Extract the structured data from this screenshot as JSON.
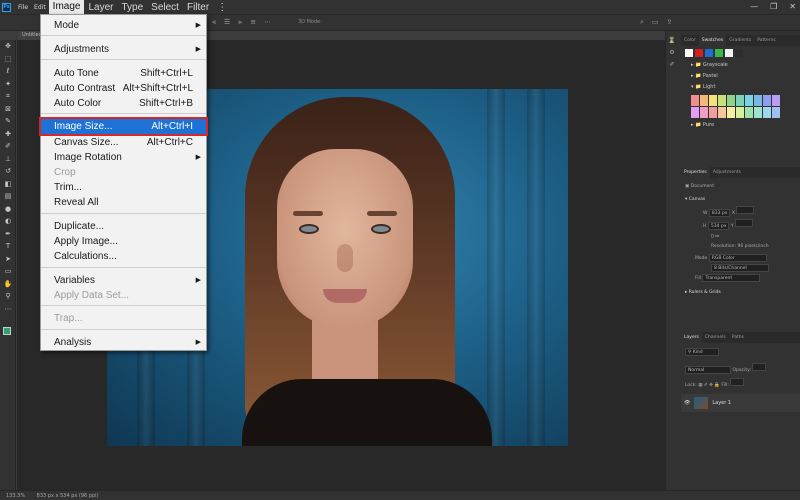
{
  "app": {
    "logo": "Ps",
    "menubar": [
      "File",
      "Edit",
      "Image",
      "Layer",
      "Type",
      "Select",
      "Filter"
    ],
    "more_menus": "⋮",
    "window_controls": [
      "—",
      "❐",
      "✕"
    ]
  },
  "options_bar": {
    "mode_3d": "3D Mode:"
  },
  "document_tab": "Untitled-1",
  "image_menu": {
    "items": [
      {
        "label": "Mode",
        "shortcut": "",
        "submenu": true,
        "disabled": false
      },
      {
        "label": "Adjustments",
        "shortcut": "",
        "submenu": true,
        "disabled": false
      },
      {
        "label": "Auto Tone",
        "shortcut": "Shift+Ctrl+L",
        "submenu": false,
        "disabled": false
      },
      {
        "label": "Auto Contrast",
        "shortcut": "Alt+Shift+Ctrl+L",
        "submenu": false,
        "disabled": false
      },
      {
        "label": "Auto Color",
        "shortcut": "Shift+Ctrl+B",
        "submenu": false,
        "disabled": false
      },
      {
        "label": "Image Size...",
        "shortcut": "Alt+Ctrl+I",
        "submenu": false,
        "disabled": false,
        "highlighted": true
      },
      {
        "label": "Canvas Size...",
        "shortcut": "Alt+Ctrl+C",
        "submenu": false,
        "disabled": false
      },
      {
        "label": "Image Rotation",
        "shortcut": "",
        "submenu": true,
        "disabled": false
      },
      {
        "label": "Crop",
        "shortcut": "",
        "submenu": false,
        "disabled": true
      },
      {
        "label": "Trim...",
        "shortcut": "",
        "submenu": false,
        "disabled": false
      },
      {
        "label": "Reveal All",
        "shortcut": "",
        "submenu": false,
        "disabled": false
      },
      {
        "label": "Duplicate...",
        "shortcut": "",
        "submenu": false,
        "disabled": false
      },
      {
        "label": "Apply Image...",
        "shortcut": "",
        "submenu": false,
        "disabled": false
      },
      {
        "label": "Calculations...",
        "shortcut": "",
        "submenu": false,
        "disabled": false
      },
      {
        "label": "Variables",
        "shortcut": "",
        "submenu": true,
        "disabled": false
      },
      {
        "label": "Apply Data Set...",
        "shortcut": "",
        "submenu": false,
        "disabled": true
      },
      {
        "label": "Trap...",
        "shortcut": "",
        "submenu": false,
        "disabled": true
      },
      {
        "label": "Analysis",
        "shortcut": "",
        "submenu": true,
        "disabled": false
      }
    ]
  },
  "swatches_panel": {
    "tabs": [
      "Color",
      "Swatches",
      "Gradients",
      "Patterns"
    ],
    "active_tab": "Swatches",
    "recent_colors": [
      "#ffffff",
      "#d22020",
      "#1f6fd2",
      "#38b84a",
      "#f2f2f2",
      "#2e2e2e"
    ],
    "groups": [
      "Grayscale",
      "Pastel",
      "Light",
      "Pure"
    ],
    "light_colors": [
      "#f08e8e",
      "#f4b77a",
      "#f7e27a",
      "#c7e27a",
      "#8ed28e",
      "#7ad2b7",
      "#7ad2e2",
      "#7ab7e2",
      "#8e9ef0",
      "#b79ef0",
      "#e29ef0",
      "#f09ec7",
      "#f09e9e",
      "#f4c79e",
      "#f7ef9e",
      "#d8ef9e",
      "#9ee2ae",
      "#9ee2cf",
      "#9ed8ef",
      "#9ebfef"
    ]
  },
  "properties_panel": {
    "tabs": [
      "Properties",
      "Adjustments"
    ],
    "kind": "Document",
    "section_canvas": "Canvas",
    "width": "833 px",
    "height": "534 px",
    "x_label": "X",
    "y_label": "Y",
    "w_label": "W",
    "h_label": "H",
    "resolution": "Resolution: 96 pixels/inch",
    "mode_label": "Mode",
    "mode_value": "RGB Color",
    "bits_value": "8 Bits/Channel",
    "fill_label": "Fill",
    "fill_value": "Transparent",
    "section_rulers": "Rulers & Grids"
  },
  "layers_panel": {
    "tabs": [
      "Layers",
      "Channels",
      "Paths"
    ],
    "filter_kind": "Kind",
    "blend_mode": "Normal",
    "opacity_label": "Opacity:",
    "lock_label": "Lock:",
    "fill_label": "Fill:",
    "layer_name": "Layer 1"
  },
  "status_bar": {
    "zoom": "133.3%",
    "doc_info": "833 px x 534 px (96 ppi)"
  }
}
